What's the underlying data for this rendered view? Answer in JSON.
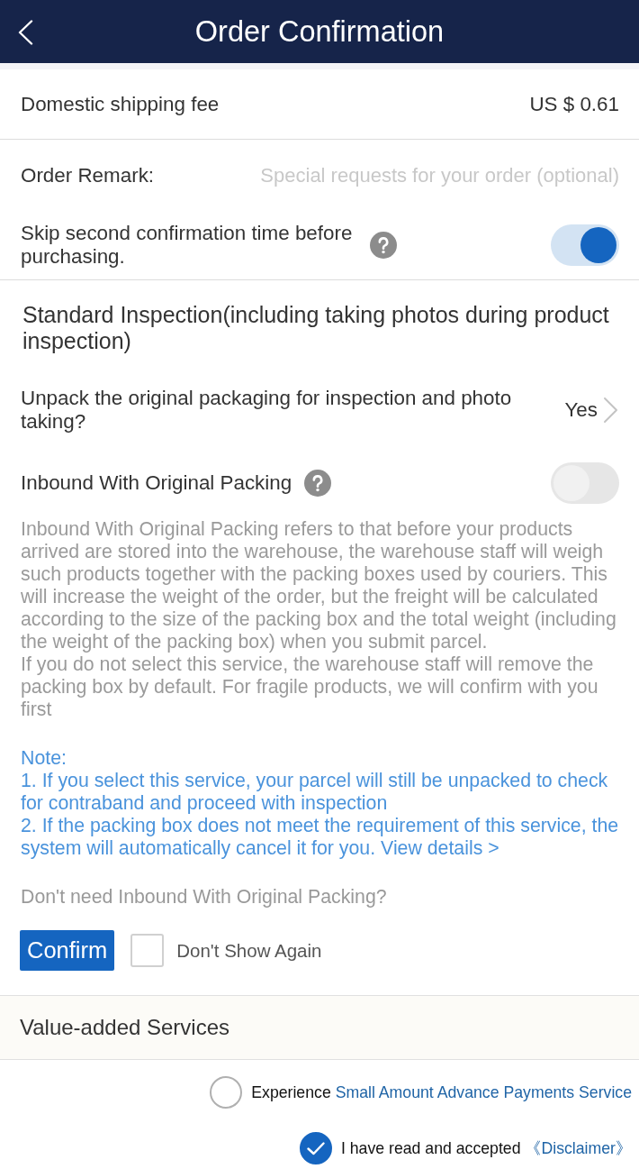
{
  "header": {
    "title": "Order Confirmation"
  },
  "shipping": {
    "label": "Domestic shipping fee",
    "value": "US $ 0.61"
  },
  "remark": {
    "label": "Order Remark:",
    "placeholder": "Special requests for your order (optional)"
  },
  "skip_confirmation": {
    "label": "Skip second confirmation time before purchasing.",
    "on": true
  },
  "inspection": {
    "title": "Standard Inspection(including taking photos during product inspection)",
    "unpack": {
      "label": "Unpack the original packaging for inspection and photo taking?",
      "value": "Yes"
    }
  },
  "inbound": {
    "label": "Inbound With Original Packing",
    "on": false,
    "description": [
      "Inbound With Original Packing refers to that before your products arrived are stored into the warehouse, the warehouse staff will weigh such products together with the packing boxes used by couriers. This will increase the weight of the order, but the freight will be calculated according to the size of the packing box and the total weight (including the weight of the packing box) when you submit parcel.",
      "If you do not select this service, the warehouse staff will remove the packing box by default. For fragile products, we will confirm with you first"
    ],
    "note": {
      "title": "Note:",
      "items": [
        "1. If you select this service, your parcel will still be unpacked to check for contraband and proceed with inspection",
        "2. If the packing box does not meet the requirement of this service, the system will automatically cancel it for you."
      ],
      "link": "View details >"
    },
    "decline_prompt": "Don't need Inbound With Original Packing?",
    "confirm_button": "Confirm",
    "dont_show_again": {
      "label": "Don't Show Again",
      "checked": false
    }
  },
  "value_added": {
    "title": "Value-added Services"
  },
  "agreements": [
    {
      "text": "Experience",
      "link": "Small Amount Advance Payments Service",
      "checked": false
    },
    {
      "text": "I have read and accepted",
      "link": "《Disclaimer》",
      "checked": true
    }
  ]
}
